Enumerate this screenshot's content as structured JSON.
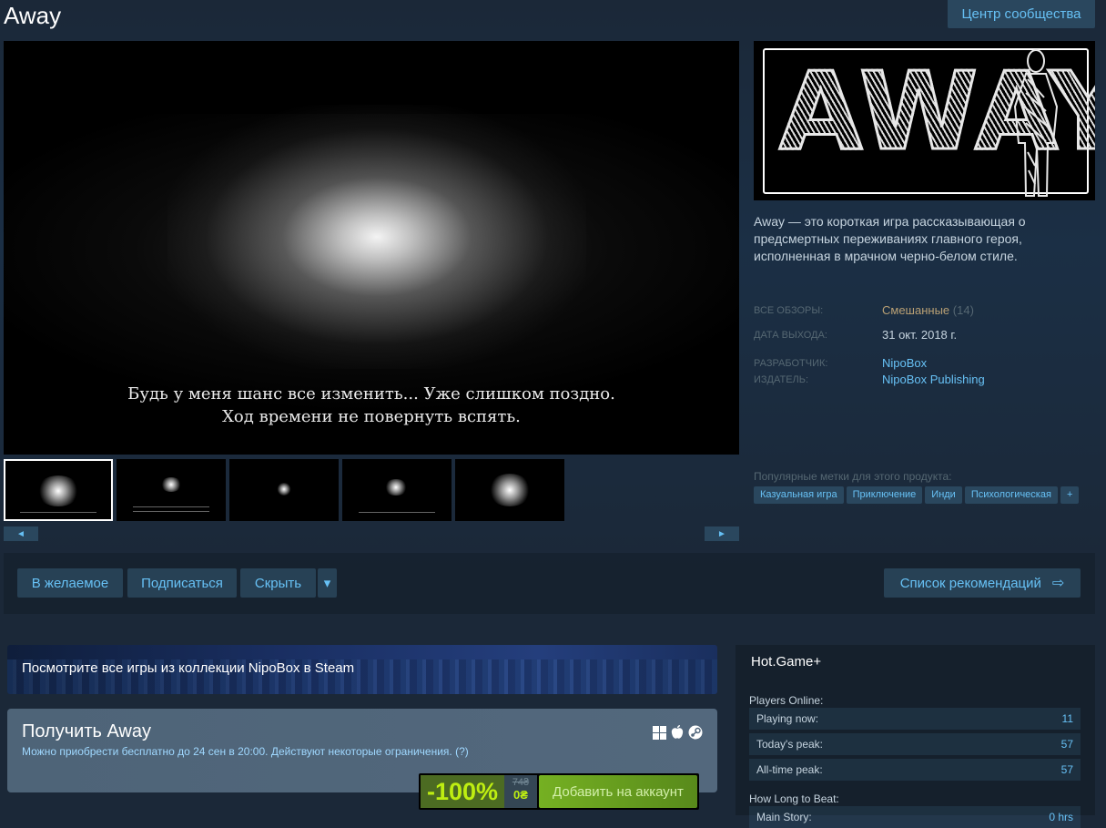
{
  "header": {
    "title": "Away",
    "community_hub_label": "Центр сообщества"
  },
  "media": {
    "subtitle_line1": "Будь у меня шанс все изменить... Уже слишком поздно.",
    "subtitle_line2": "Ход времени не повернуть вспять.",
    "thumbnails_count": 5,
    "scroll_left": "◄",
    "scroll_right": "►"
  },
  "capsule": {
    "logo_text": "AWAY"
  },
  "description": "Away — это короткая игра рассказывающая о предсмертных переживаниях главного героя, исполненная в мрачном черно-белом стиле.",
  "meta": {
    "reviews_label": "ВСЕ ОБЗОРЫ:",
    "reviews_value": "Смешанные",
    "reviews_count": "(14)",
    "release_label": "ДАТА ВЫХОДА:",
    "release_value": "31 окт. 2018 г.",
    "developer_label": "РАЗРАБОТЧИК:",
    "developer_value": "NipoBox",
    "publisher_label": "ИЗДАТЕЛЬ:",
    "publisher_value": "NipoBox Publishing"
  },
  "tags": {
    "label": "Популярные метки для этого продукта:",
    "items": [
      "Казуальная игра",
      "Приключение",
      "Инди",
      "Психологическая",
      "+"
    ]
  },
  "actions": {
    "wishlist": "В желаемое",
    "follow": "Подписаться",
    "ignore": "Скрыть",
    "dropdown": "▾",
    "queue": "Список рекомендаций",
    "queue_icon": "⇨"
  },
  "developer_banner": "Посмотрите все игры из коллекции NipoBox в Steam",
  "purchase": {
    "title": "Получить Away",
    "subtitle": "Можно приобрести бесплатно до 24 сен в 20:00. Действуют некоторые ограничения. (?)",
    "discount": "-100%",
    "original_price": "74₴",
    "final_price": "0₴",
    "add_button": "Добавить на аккаунт"
  },
  "side_panel": {
    "title": "Hot.Game+",
    "players_header": "Players Online:",
    "stats": [
      {
        "label": "Playing now:",
        "value": "11"
      },
      {
        "label": "Today's peak:",
        "value": "57"
      },
      {
        "label": "All-time peak:",
        "value": "57"
      }
    ],
    "hltb_header": "How Long to Beat:",
    "hltb_row_label": "Main Story:",
    "hltb_row_value": "0 hrs"
  },
  "colors": {
    "background": "#1b2838",
    "link": "#67c1f5",
    "mixed_review": "#b9a074",
    "discount_green": "#beee11"
  }
}
